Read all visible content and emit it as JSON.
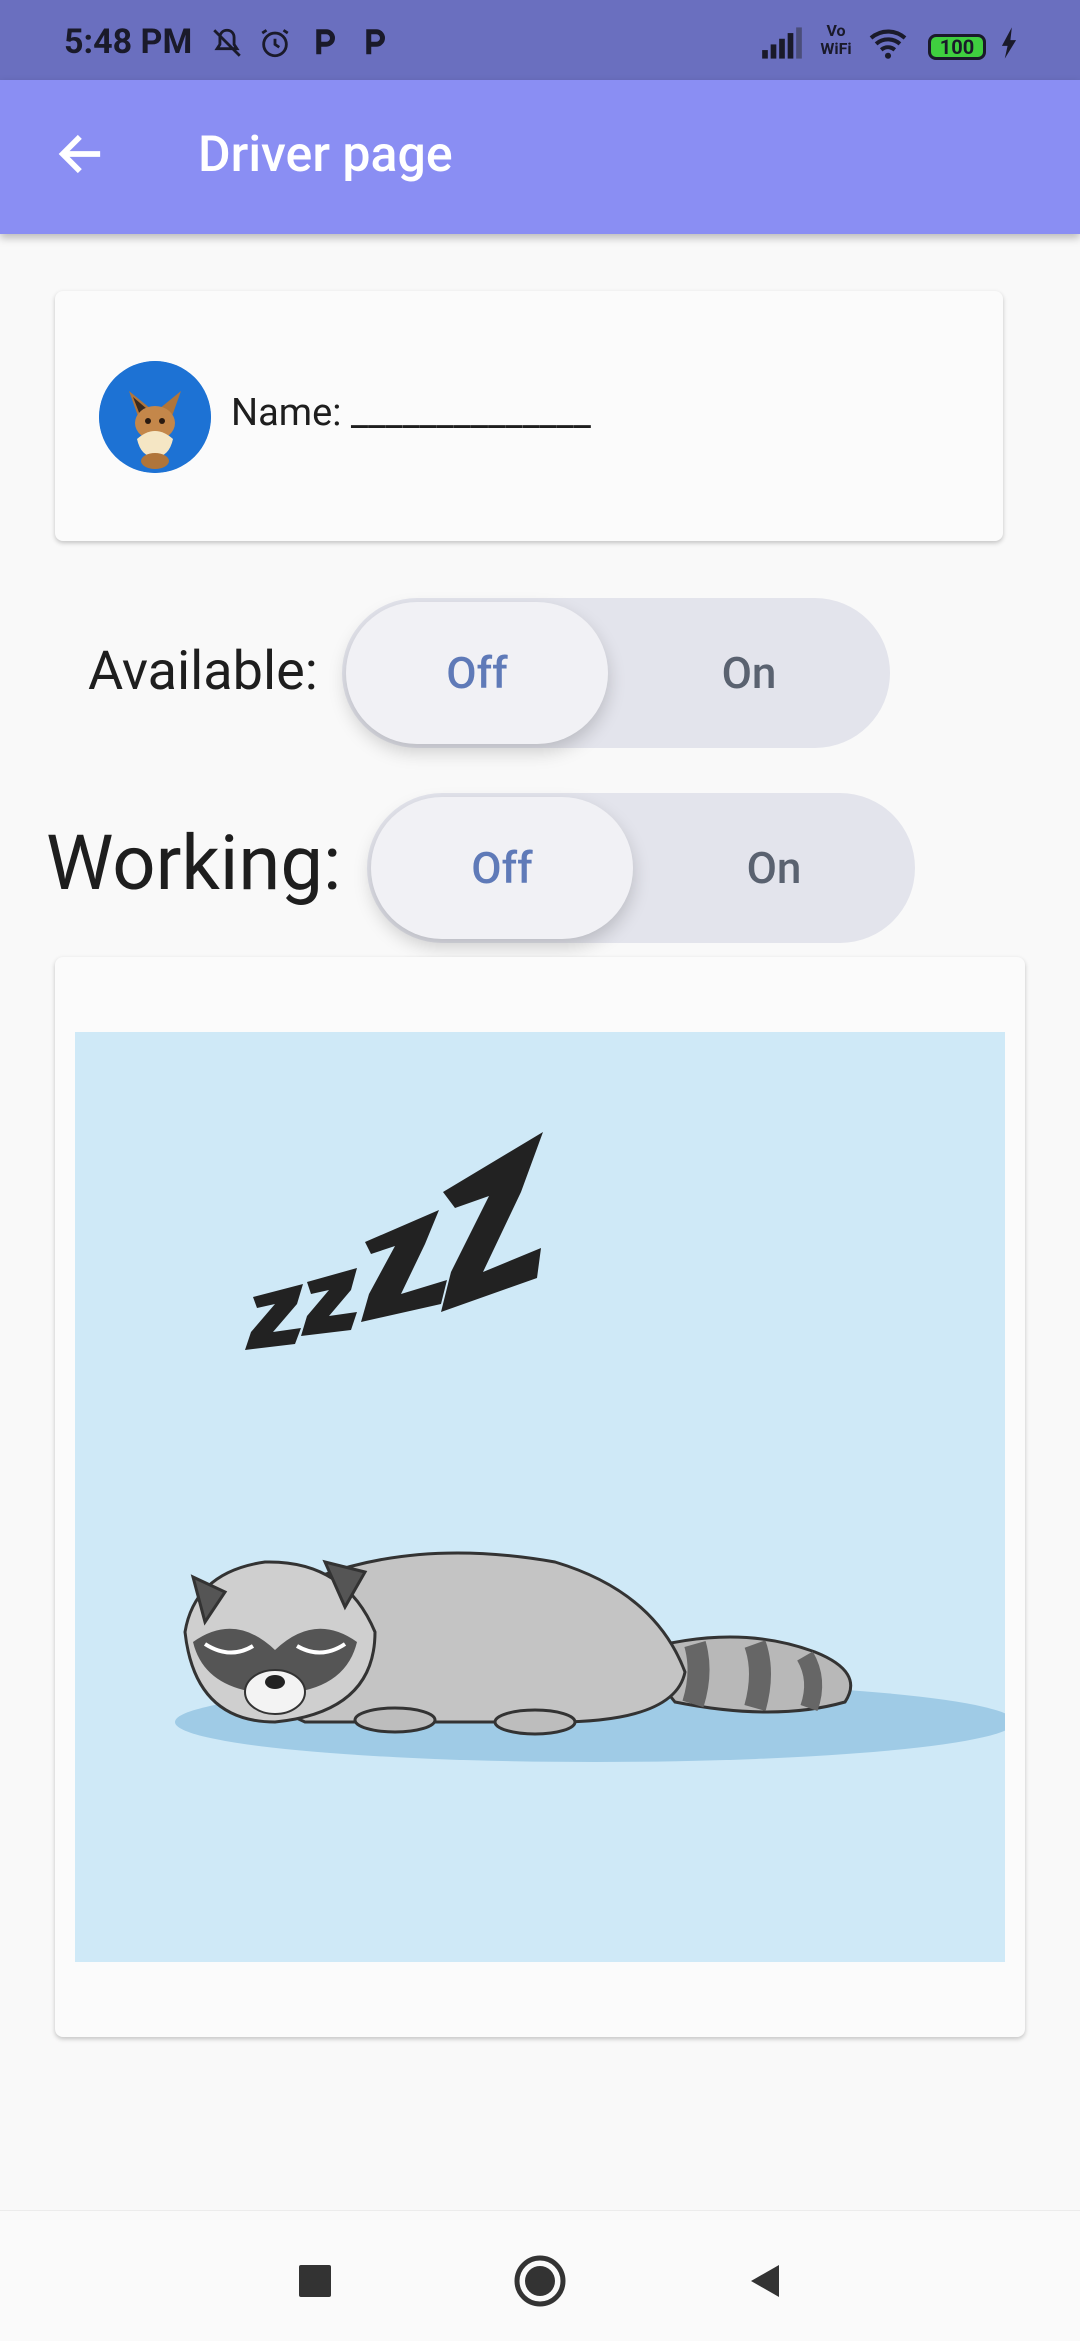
{
  "status_bar": {
    "time": "5:48 PM",
    "left_icons": [
      "bell-off-icon",
      "alarm-icon",
      "parking-icon",
      "parking-icon"
    ],
    "right_icons": [
      "signal-icon",
      "vowifi-icon",
      "wifi-icon",
      "battery-icon",
      "charging-icon"
    ],
    "vowifi_text": "Vo WiFi",
    "battery_level": "100"
  },
  "app_bar": {
    "title": "Driver page",
    "back_icon": "arrow-back-icon",
    "color": "#8a8ef3"
  },
  "profile": {
    "name_label": "Name: ______________",
    "avatar_icon": "eevee-avatar"
  },
  "toggles": {
    "available": {
      "label": "Available:",
      "off": "Off",
      "on": "On",
      "selected": "Off"
    },
    "working": {
      "label": "Working:",
      "off": "Off",
      "on": "On",
      "selected": "Off"
    }
  },
  "image": {
    "subject": "sleeping-raccoon-illustration",
    "background": "#cfe9f7"
  },
  "nav_bar": {
    "buttons": [
      "recents-square-icon",
      "home-circle-icon",
      "back-triangle-icon"
    ]
  }
}
